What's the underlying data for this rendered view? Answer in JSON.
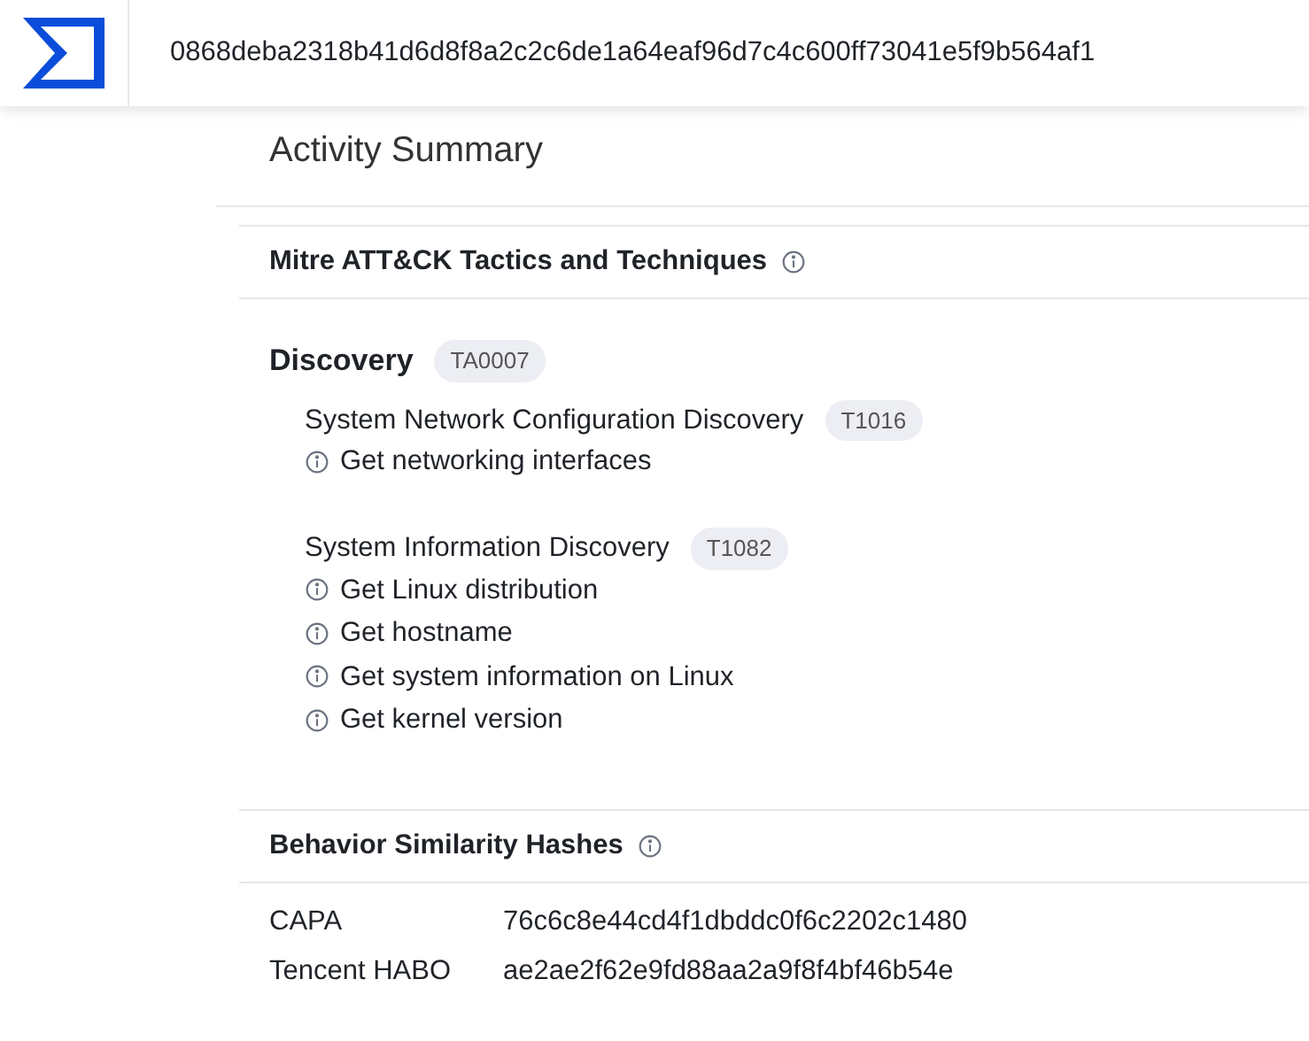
{
  "header": {
    "hash": "0868deba2318b41d6d8f8a2c2c6de1a64eaf96d7c4c600ff73041e5f9b564af1"
  },
  "activity_summary": {
    "title": "Activity Summary"
  },
  "mitre": {
    "title": "Mitre ATT&CK Tactics and Techniques",
    "tactics": [
      {
        "name": "Discovery",
        "id": "TA0007",
        "techniques": [
          {
            "name": "System Network Configuration Discovery",
            "id": "T1016",
            "behaviors": [
              "Get networking interfaces"
            ]
          },
          {
            "name": "System Information Discovery",
            "id": "T1082",
            "behaviors": [
              "Get Linux distribution",
              "Get hostname",
              "Get system information on Linux",
              "Get kernel version"
            ]
          }
        ]
      }
    ]
  },
  "hashes": {
    "title": "Behavior Similarity Hashes",
    "rows": [
      {
        "label": "CAPA",
        "value": "76c6c8e44cd4f1dbddc0f6c2202c1480"
      },
      {
        "label": "Tencent HABO",
        "value": "ae2ae2f62e9fd88aa2a9f8f4bf46b54e"
      }
    ]
  }
}
